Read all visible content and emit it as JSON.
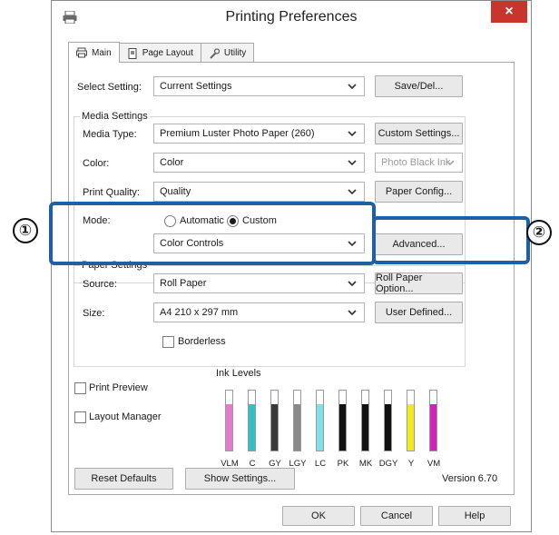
{
  "window": {
    "title": "Printing Preferences",
    "close_glyph": "×",
    "app_icon": "printer-icon"
  },
  "tabs": [
    {
      "label": "Main",
      "icon": "printer-icon"
    },
    {
      "label": "Page Layout",
      "icon": "page-icon"
    },
    {
      "label": "Utility",
      "icon": "wrench-icon"
    }
  ],
  "select_setting": {
    "label": "Select Setting:",
    "value": "Current Settings",
    "save_button": "Save/Del..."
  },
  "media_settings": {
    "group_title": "Media Settings",
    "media_type_label": "Media Type:",
    "media_type_value": "Premium Luster Photo Paper (260)",
    "custom_settings_button": "Custom Settings...",
    "color_label": "Color:",
    "color_value": "Color",
    "ink_value": "Photo Black Ink",
    "print_quality_label": "Print Quality:",
    "print_quality_value": "Quality",
    "paper_config_button": "Paper Config...",
    "mode_label": "Mode:",
    "mode_automatic": "Automatic",
    "mode_custom": "Custom",
    "mode_selected": "Custom",
    "mode_custom_value": "Color Controls",
    "advanced_button": "Advanced..."
  },
  "paper_settings": {
    "group_title": "Paper Settings",
    "source_label": "Source:",
    "source_value": "Roll Paper",
    "roll_paper_option_button": "Roll Paper Option...",
    "size_label": "Size:",
    "size_value": "A4 210 x 297 mm",
    "user_defined_button": "User Defined...",
    "borderless_label": "Borderless",
    "borderless_checked": false
  },
  "options": {
    "print_preview_label": "Print Preview",
    "print_preview_checked": false,
    "layout_manager_label": "Layout Manager",
    "layout_manager_checked": false
  },
  "ink_levels": {
    "title": "Ink Levels",
    "inks": [
      {
        "code": "VLM",
        "color": "#e07bd0",
        "level": 0.78
      },
      {
        "code": "C",
        "color": "#2cc4c4",
        "level": 0.78
      },
      {
        "code": "GY",
        "color": "#3a3a3a",
        "level": 0.78
      },
      {
        "code": "LGY",
        "color": "#8a8a8a",
        "level": 0.78
      },
      {
        "code": "LC",
        "color": "#7fe0e8",
        "level": 0.78
      },
      {
        "code": "PK",
        "color": "#111111",
        "level": 0.78
      },
      {
        "code": "MK",
        "color": "#111111",
        "level": 0.78
      },
      {
        "code": "DGY",
        "color": "#111111",
        "level": 0.78
      },
      {
        "code": "Y",
        "color": "#f2ea1c",
        "level": 0.78
      },
      {
        "code": "VM",
        "color": "#d41fb8",
        "level": 0.78
      }
    ]
  },
  "footer": {
    "reset_defaults_button": "Reset Defaults",
    "show_settings_button": "Show Settings...",
    "version": "Version 6.70",
    "ok_button": "OK",
    "cancel_button": "Cancel",
    "help_button": "Help"
  },
  "callouts": {
    "one": "①",
    "two": "②",
    "color": "#1f5fa3"
  }
}
